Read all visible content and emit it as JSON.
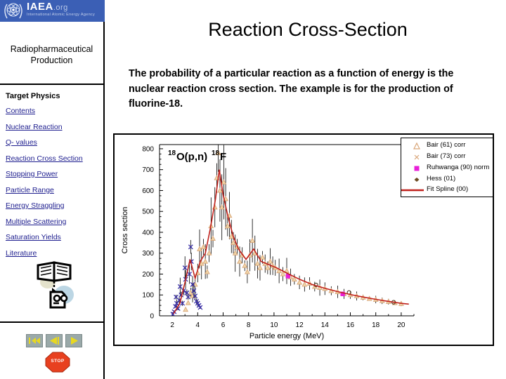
{
  "sidebar": {
    "logo": {
      "wordmark": "IAEA",
      "domain": ".org",
      "tagline": "International Atomic Energy Agency",
      "banner_color": "#3b5fb5"
    },
    "title": "Radiopharmaceutical Production",
    "nav_heading": "Target Physics",
    "links": [
      "Contents",
      "Nuclear Reaction",
      "Q- values",
      "Reaction Cross Section",
      "Stopping Power",
      "Particle Range",
      "Energy Straggling",
      "Multiple Scattering",
      "Saturation Yields",
      "Literature"
    ],
    "link_color": "#1d1d8e",
    "buttons": [
      {
        "name": "first-slide",
        "glyph": "|<<"
      },
      {
        "name": "previous-slide",
        "glyph": "<|"
      },
      {
        "name": "next-slide",
        "glyph": "|>"
      }
    ],
    "stop_label": "STOP",
    "stop_color": "#e8401f"
  },
  "main": {
    "title": "Reaction Cross-Section",
    "body": "The probability of a particular reaction as a function of energy is the nuclear reaction cross section.  The example is for the production of fluorine-18."
  },
  "chart_data": {
    "type": "scatter",
    "title": "",
    "annotation": {
      "pre_sup": "18",
      "target": "O(p,n)",
      "post_sup": "18",
      "product": "F"
    },
    "xlabel": "Particle energy (MeV)",
    "ylabel": "Cross section",
    "xlim": [
      1,
      21
    ],
    "ylim": [
      0,
      820
    ],
    "xticks": [
      2,
      4,
      6,
      8,
      10,
      12,
      14,
      16,
      18,
      20
    ],
    "yticks": [
      0,
      100,
      200,
      300,
      400,
      500,
      600,
      700,
      800
    ],
    "grid": false,
    "legend_position": "top-right",
    "series": [
      {
        "name": "Bair (61) corr",
        "marker": "triangle",
        "color": "#d9a679",
        "points": [
          [
            3.05,
            30
          ],
          [
            3.25,
            62
          ],
          [
            3.45,
            110
          ],
          [
            3.6,
            95
          ],
          [
            3.8,
            150
          ],
          [
            4.0,
            205
          ],
          [
            4.15,
            320
          ],
          [
            4.3,
            250
          ],
          [
            4.45,
            330
          ],
          [
            4.6,
            260
          ],
          [
            4.75,
            210
          ],
          [
            4.9,
            300
          ],
          [
            5.05,
            430
          ],
          [
            5.2,
            370
          ],
          [
            5.35,
            520
          ],
          [
            5.5,
            660
          ],
          [
            5.62,
            780
          ],
          [
            5.75,
            600
          ],
          [
            5.9,
            520
          ],
          [
            6.05,
            640
          ],
          [
            6.2,
            560
          ],
          [
            6.35,
            430
          ],
          [
            6.5,
            480
          ],
          [
            6.65,
            380
          ],
          [
            6.8,
            350
          ],
          [
            6.95,
            300
          ],
          [
            7.1,
            330
          ],
          [
            7.3,
            260
          ],
          [
            7.5,
            290
          ],
          [
            7.7,
            240
          ],
          [
            7.9,
            210
          ],
          [
            8.1,
            290
          ],
          [
            8.3,
            360
          ],
          [
            8.5,
            300
          ],
          [
            8.7,
            250
          ],
          [
            8.9,
            230
          ],
          [
            9.1,
            280
          ],
          [
            9.3,
            250
          ],
          [
            9.5,
            230
          ],
          [
            9.7,
            260
          ],
          [
            9.9,
            240
          ],
          [
            10.1,
            230
          ],
          [
            10.4,
            215
          ],
          [
            10.7,
            200
          ],
          [
            11.0,
            215
          ],
          [
            11.3,
            185
          ],
          [
            11.6,
            175
          ],
          [
            12.0,
            160
          ],
          [
            12.4,
            150
          ],
          [
            12.8,
            155
          ],
          [
            13.2,
            140
          ],
          [
            13.6,
            135
          ],
          [
            14.0,
            130
          ],
          [
            14.5,
            120
          ],
          [
            15.0,
            115
          ],
          [
            15.5,
            105
          ],
          [
            16.0,
            100
          ],
          [
            16.5,
            95
          ],
          [
            17.0,
            88
          ],
          [
            17.5,
            82
          ],
          [
            18.0,
            78
          ],
          [
            18.5,
            72
          ],
          [
            19.0,
            68
          ],
          [
            19.5,
            62
          ],
          [
            20.0,
            58
          ]
        ]
      },
      {
        "name": "Bair (73) corr",
        "marker": "cross",
        "color": "#3a2fa8",
        "points": [
          [
            2.05,
            8
          ],
          [
            2.15,
            20
          ],
          [
            2.25,
            45
          ],
          [
            2.3,
            90
          ],
          [
            2.35,
            60
          ],
          [
            2.45,
            35
          ],
          [
            2.55,
            75
          ],
          [
            2.62,
            140
          ],
          [
            2.7,
            100
          ],
          [
            2.8,
            60
          ],
          [
            2.9,
            120
          ],
          [
            3.0,
            230
          ],
          [
            3.05,
            175
          ],
          [
            3.15,
            110
          ],
          [
            3.25,
            90
          ],
          [
            3.35,
            200
          ],
          [
            3.45,
            330
          ],
          [
            3.5,
            260
          ],
          [
            3.6,
            150
          ],
          [
            3.7,
            120
          ],
          [
            3.8,
            95
          ],
          [
            3.9,
            70
          ],
          [
            4.0,
            60
          ],
          [
            4.1,
            50
          ],
          [
            4.2,
            40
          ]
        ]
      },
      {
        "name": "Ruhwanga (90) norm",
        "marker": "square",
        "color": "#e81fd8",
        "points": [
          [
            11.1,
            190
          ],
          [
            15.4,
            105
          ]
        ]
      },
      {
        "name": "Hess (01)",
        "marker": "diamond",
        "color": "#6b4a20",
        "points": [
          [
            13.3,
            148
          ],
          [
            15.9,
            112
          ],
          [
            19.4,
            65
          ]
        ]
      },
      {
        "name": "Fit Spline (00)",
        "marker": "line",
        "color": "#c0211c",
        "points": [
          [
            2.1,
            10
          ],
          [
            2.6,
            60
          ],
          [
            3.0,
            160
          ],
          [
            3.4,
            270
          ],
          [
            3.8,
            180
          ],
          [
            4.2,
            260
          ],
          [
            4.6,
            300
          ],
          [
            5.0,
            420
          ],
          [
            5.4,
            560
          ],
          [
            5.7,
            700
          ],
          [
            6.0,
            580
          ],
          [
            6.4,
            470
          ],
          [
            6.8,
            380
          ],
          [
            7.2,
            320
          ],
          [
            7.8,
            270
          ],
          [
            8.4,
            320
          ],
          [
            9.0,
            260
          ],
          [
            9.6,
            245
          ],
          [
            10.2,
            230
          ],
          [
            11.0,
            205
          ],
          [
            12.0,
            175
          ],
          [
            13.0,
            150
          ],
          [
            14.0,
            132
          ],
          [
            15.0,
            116
          ],
          [
            16.0,
            102
          ],
          [
            17.0,
            90
          ],
          [
            18.0,
            79
          ],
          [
            19.0,
            69
          ],
          [
            20.0,
            60
          ],
          [
            20.6,
            56
          ]
        ]
      }
    ]
  }
}
